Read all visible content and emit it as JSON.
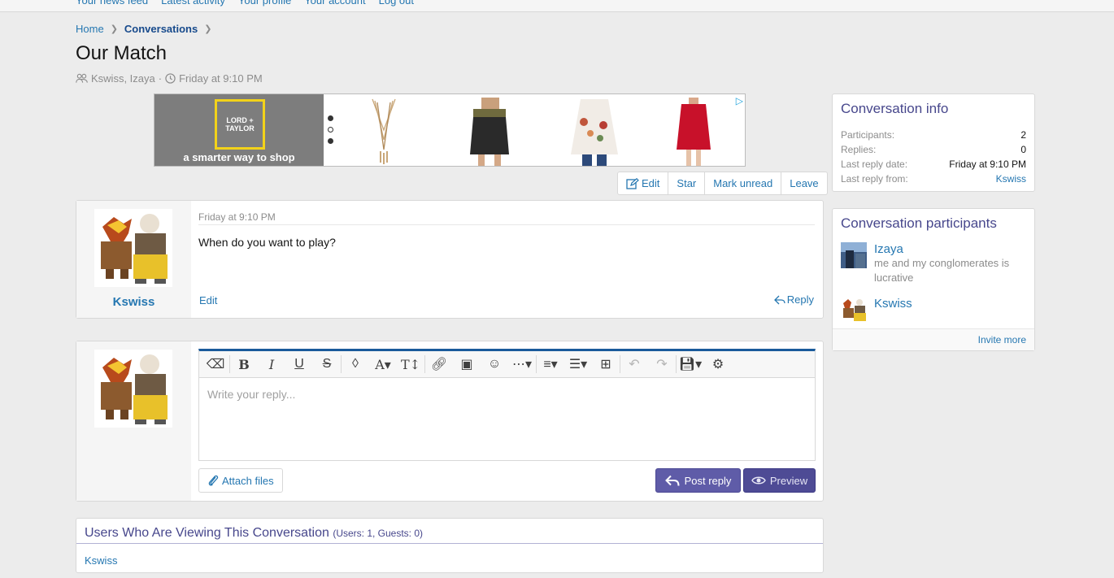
{
  "topnav": {
    "links": [
      "Your news feed",
      "Latest activity",
      "Your profile",
      "Your account",
      "Log out"
    ]
  },
  "breadcrumb": {
    "items": [
      "Home",
      "Conversations"
    ]
  },
  "page": {
    "title": "Our Match",
    "participants_meta": "Kswiss, Izaya",
    "separator": "·",
    "date_meta": "Friday at 9:10 PM"
  },
  "ad": {
    "logo_line1": "LORD + ",
    "logo_line2": "TAYLOR",
    "tagline": "a smarter way to shop"
  },
  "actions": {
    "edit": "Edit",
    "star": "Star",
    "mark_unread": "Mark unread",
    "leave": "Leave"
  },
  "message": {
    "date": "Friday at 9:10 PM",
    "body": "When do you want to play?",
    "username": "Kswiss",
    "edit_label": "Edit",
    "reply_label": "Reply"
  },
  "reply": {
    "placeholder": "Write your reply...",
    "attach_label": "Attach files",
    "post_label": "Post reply",
    "preview_label": "Preview"
  },
  "viewing": {
    "title": "Users Who Are Viewing This Conversation",
    "counts": "(Users: 1, Guests: 0)",
    "users": "Kswiss"
  },
  "conversation_info": {
    "title": "Conversation info",
    "rows": [
      {
        "key": "Participants:",
        "value": "2"
      },
      {
        "key": "Replies:",
        "value": "0"
      },
      {
        "key": "Last reply date:",
        "value": "Friday at 9:10 PM"
      },
      {
        "key": "Last reply from:",
        "value": "Kswiss"
      }
    ]
  },
  "participants": {
    "title": "Conversation participants",
    "items": [
      {
        "name": "Izaya",
        "subtitle": "me and my conglomerates is lucrative"
      },
      {
        "name": "Kswiss",
        "subtitle": ""
      }
    ],
    "invite_label": "Invite more"
  },
  "colors": {
    "link": "#2577b1",
    "heading": "#47478c",
    "primary_button": "#5f5ca8",
    "editor_accent": "#1a5a9b"
  }
}
